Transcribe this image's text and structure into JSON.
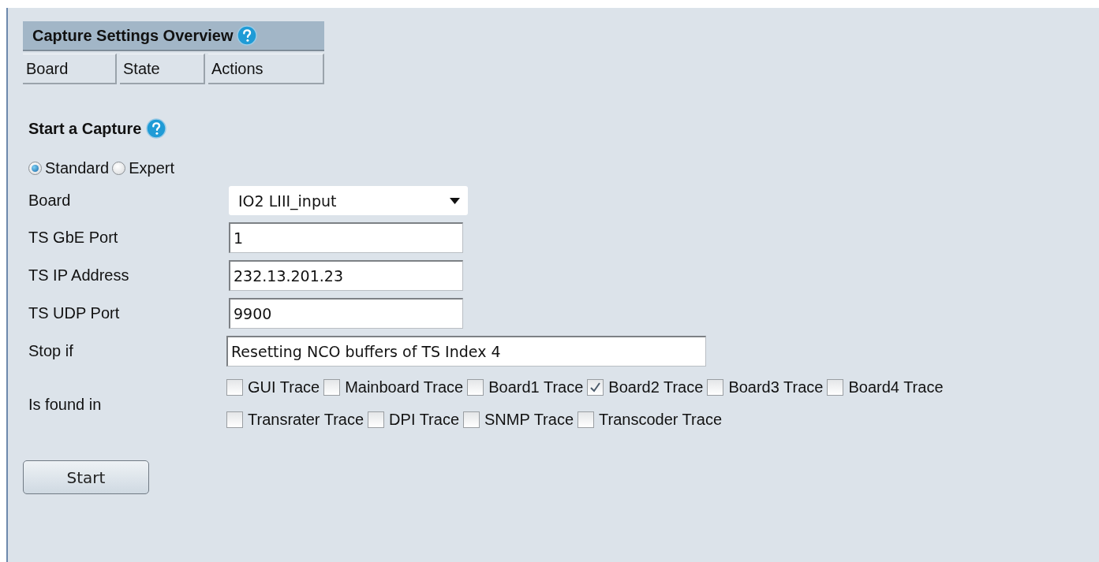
{
  "overview": {
    "title": "Capture Settings Overview",
    "columns": [
      "Board",
      "State",
      "Actions"
    ]
  },
  "capture": {
    "title": "Start a Capture",
    "modes": [
      {
        "label": "Standard",
        "selected": true
      },
      {
        "label": "Expert",
        "selected": false
      }
    ],
    "fields": [
      {
        "kind": "select",
        "label": "Board",
        "value": "IO2 LIII_input"
      },
      {
        "kind": "text",
        "label": "TS GbE Port",
        "value": "1"
      },
      {
        "kind": "text",
        "label": "TS IP Address",
        "value": "232.13.201.23"
      },
      {
        "kind": "text",
        "label": "TS UDP Port",
        "value": "9900"
      },
      {
        "kind": "long-text",
        "label": "Stop if",
        "value": "Resetting NCO buffers of TS Index 4"
      }
    ],
    "found_in": {
      "label": "Is found in",
      "traces": [
        {
          "label": "GUI Trace",
          "checked": false
        },
        {
          "label": "Mainboard Trace",
          "checked": false
        },
        {
          "label": "Board1 Trace",
          "checked": false
        },
        {
          "label": "Board2 Trace",
          "checked": true
        },
        {
          "label": "Board3 Trace",
          "checked": false
        },
        {
          "label": "Board4 Trace",
          "checked": false
        },
        {
          "label": "Transrater Trace",
          "checked": false
        },
        {
          "label": "DPI Trace",
          "checked": false
        },
        {
          "label": "SNMP Trace",
          "checked": false
        },
        {
          "label": "Transcoder Trace",
          "checked": false
        }
      ]
    },
    "start_button": "Start"
  }
}
